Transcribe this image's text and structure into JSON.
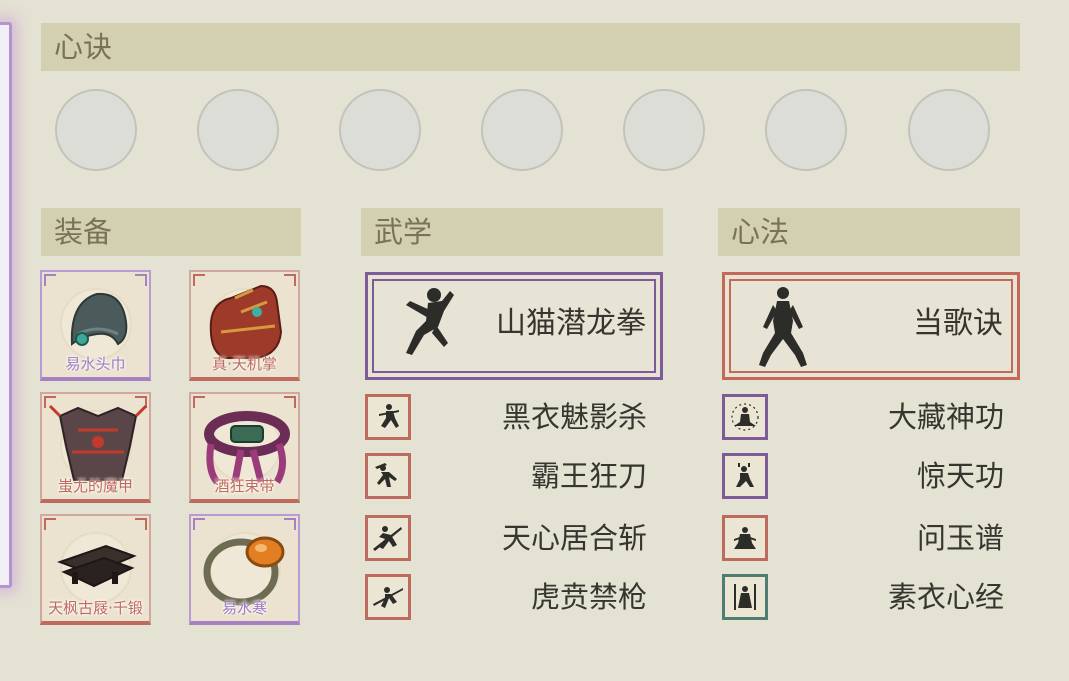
{
  "sections": {
    "xinjue": "心诀",
    "equipment": "装备",
    "martial": "武学",
    "xinfa": "心法"
  },
  "xinjue_slots": [
    "empty",
    "empty",
    "empty",
    "empty",
    "empty",
    "empty",
    "empty"
  ],
  "equipment": [
    {
      "name": "易水头巾",
      "rarity": "purple",
      "icon": "headscarf-icon"
    },
    {
      "name": "真·天机掌",
      "rarity": "red",
      "icon": "gauntlet-icon"
    },
    {
      "name": "蚩尤的魔甲",
      "rarity": "red",
      "icon": "armor-icon"
    },
    {
      "name": "酒狂束带",
      "rarity": "red",
      "icon": "belt-icon"
    },
    {
      "name": "天枫古屐·千锻",
      "rarity": "red",
      "icon": "clogs-icon"
    },
    {
      "name": "易水寒",
      "rarity": "purple",
      "icon": "ring-icon"
    }
  ],
  "martial": {
    "main": {
      "name": "山猫潜龙拳",
      "rarity": "purple",
      "icon": "kick-figure-icon"
    },
    "list": [
      {
        "name": "黑衣魅影杀",
        "rarity": "red",
        "icon": "assassin-figure-icon"
      },
      {
        "name": "霸王狂刀",
        "rarity": "red",
        "icon": "blade-figure-icon"
      },
      {
        "name": "天心居合斩",
        "rarity": "red",
        "icon": "slash-figure-icon"
      },
      {
        "name": "虎贲禁枪",
        "rarity": "red",
        "icon": "spear-figure-icon"
      }
    ]
  },
  "xinfa": {
    "main": {
      "name": "当歌诀",
      "rarity": "red",
      "icon": "stance-figure-icon"
    },
    "list": [
      {
        "name": "大藏神功",
        "rarity": "purple",
        "icon": "meditate-figure-icon"
      },
      {
        "name": "惊天功",
        "rarity": "purple",
        "icon": "crouch-figure-icon"
      },
      {
        "name": "问玉谱",
        "rarity": "red",
        "icon": "seated-figure-icon"
      },
      {
        "name": "素衣心经",
        "rarity": "green",
        "icon": "robed-figure-icon"
      }
    ]
  },
  "colors": {
    "background": "#e4e2d2",
    "header": "#d3cfb1",
    "header_text": "#7a7256",
    "purple_rarity": "#7e5b98",
    "red_rarity": "#c4685a",
    "green_rarity": "#4f7d72"
  }
}
